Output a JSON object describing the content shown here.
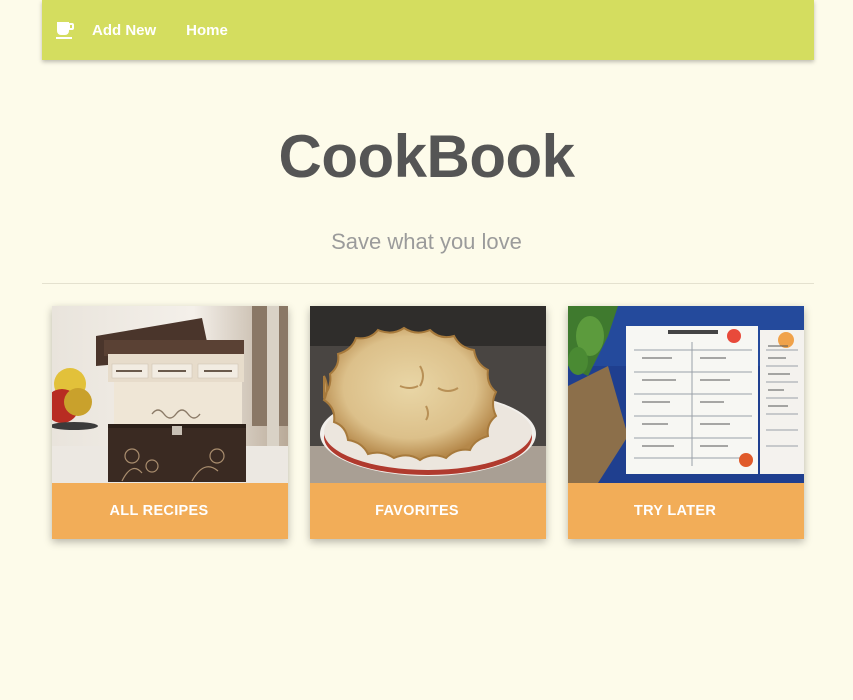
{
  "navbar": {
    "icon": "coffee-cup-icon",
    "links": [
      "Add New",
      "Home"
    ],
    "color": "#d4dd5f"
  },
  "header": {
    "title": "CookBook",
    "subtitle": "Save what you love"
  },
  "cards": [
    {
      "label": "ALL RECIPES",
      "image": "recipe-box-photo"
    },
    {
      "label": "FAVORITES",
      "image": "pie-photo"
    },
    {
      "label": "TRY LATER",
      "image": "meal-plan-photo"
    }
  ],
  "colors": {
    "background": "#fdfbea",
    "card": "#f2ad58",
    "title": "#555555",
    "subtitle": "#9b9b9b"
  }
}
